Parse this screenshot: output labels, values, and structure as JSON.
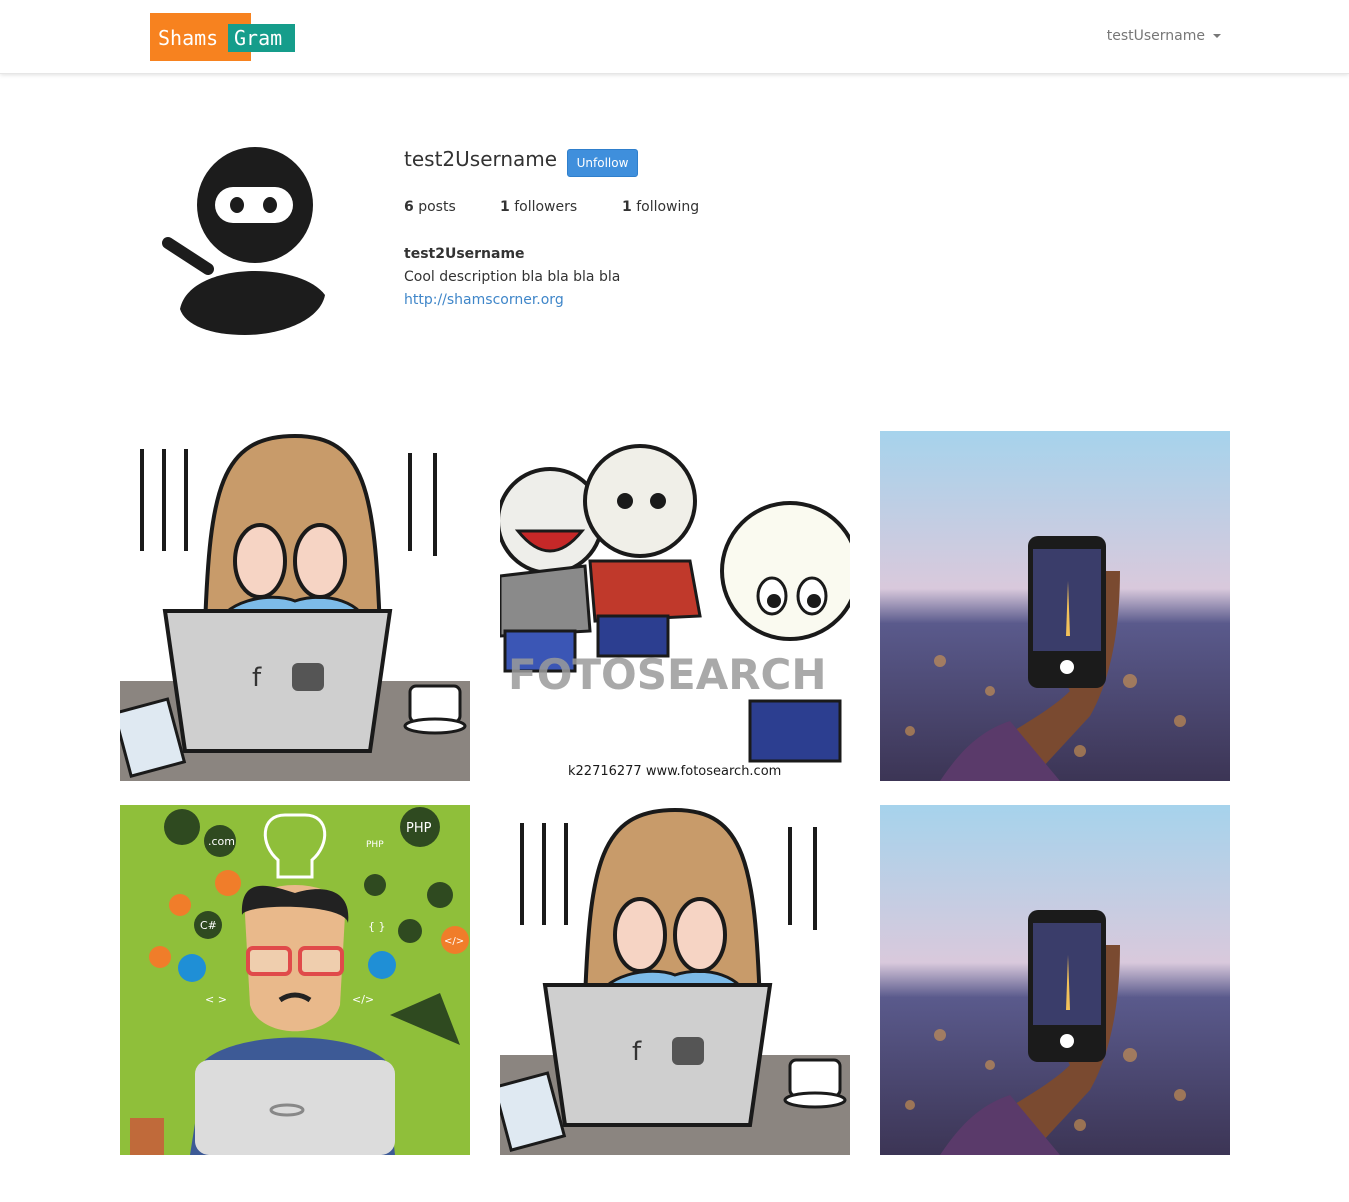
{
  "navbar": {
    "logo_part1": "Shams",
    "logo_part2": "Gram",
    "current_user": "testUsername"
  },
  "profile": {
    "username": "test2Username",
    "unfollow_label": "Unfollow",
    "posts_count": "6",
    "posts_label": "posts",
    "followers_count": "1",
    "followers_label": "followers",
    "following_count": "1",
    "following_label": "following",
    "display_name": "test2Username",
    "description": "Cool description bla bla bla bla",
    "website": "http://shamscorner.org"
  },
  "posts": [
    {
      "image": "girl-covering-face-at-laptop-illustration"
    },
    {
      "image": "cartoon-kids-bullying-illustration",
      "watermark": "FOTOSEARCH",
      "caption": "k22716277 www.fotosearch.com"
    },
    {
      "image": "hand-holding-phone-over-city-photo"
    },
    {
      "image": "developer-with-laptop-and-icons-illustration",
      "labels": [
        ".com",
        "PHP",
        "PHP",
        "C#",
        "{ }",
        "< >",
        "</>",
        "</>"
      ]
    },
    {
      "image": "girl-covering-face-at-laptop-illustration"
    },
    {
      "image": "hand-holding-phone-over-city-photo"
    }
  ],
  "colors": {
    "logo_orange": "#f7821f",
    "logo_teal": "#159d8b",
    "button_blue": "#3f8fdc",
    "link_blue": "#3f86c9"
  }
}
